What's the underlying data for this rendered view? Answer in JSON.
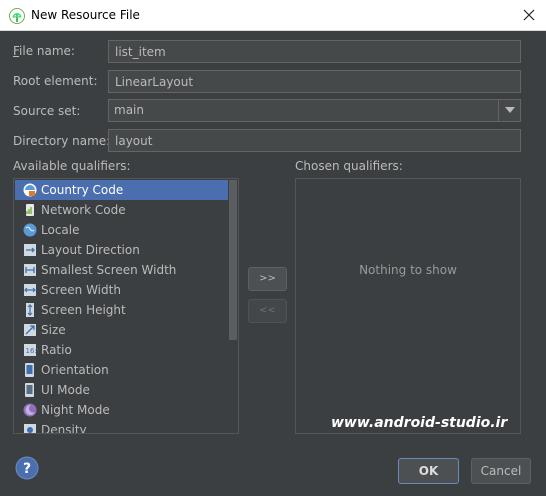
{
  "window": {
    "title": "New Resource File",
    "app_icon": "android-studio-icon",
    "close_icon": "close-icon"
  },
  "form": {
    "file_name": {
      "label": "File name:",
      "value": "list_item"
    },
    "root_element": {
      "label": "Root element:",
      "value": "LinearLayout"
    },
    "source_set": {
      "label": "Source set:",
      "value": "main",
      "arrow_icon": "chevron-down-icon"
    },
    "directory_name": {
      "label": "Directory name:",
      "value": "layout"
    }
  },
  "qualifiers": {
    "available_label": "Available qualifiers:",
    "chosen_label": "Chosen qualifiers:",
    "add_label": ">>",
    "remove_label": "<<",
    "empty_text": "Nothing to show",
    "items": [
      {
        "label": "Country Code",
        "icon": "country-code-icon",
        "selected": true
      },
      {
        "label": "Network Code",
        "icon": "network-code-icon"
      },
      {
        "label": "Locale",
        "icon": "globe-icon"
      },
      {
        "label": "Layout Direction",
        "icon": "layout-direction-icon"
      },
      {
        "label": "Smallest Screen Width",
        "icon": "smallest-width-icon"
      },
      {
        "label": "Screen Width",
        "icon": "screen-width-icon"
      },
      {
        "label": "Screen Height",
        "icon": "screen-height-icon"
      },
      {
        "label": "Size",
        "icon": "size-icon"
      },
      {
        "label": "Ratio",
        "icon": "ratio-icon"
      },
      {
        "label": "Orientation",
        "icon": "orientation-icon"
      },
      {
        "label": "UI Mode",
        "icon": "ui-mode-icon"
      },
      {
        "label": "Night Mode",
        "icon": "night-mode-icon"
      },
      {
        "label": "Density",
        "icon": "density-icon"
      }
    ]
  },
  "watermark": "www.android-studio.ir",
  "buttons": {
    "ok": "OK",
    "cancel": "Cancel",
    "help_icon": "help-icon"
  },
  "colors": {
    "background": "#3c3f41",
    "selection": "#4b6eaf",
    "field": "#45494a",
    "text": "#bbbbbb"
  }
}
